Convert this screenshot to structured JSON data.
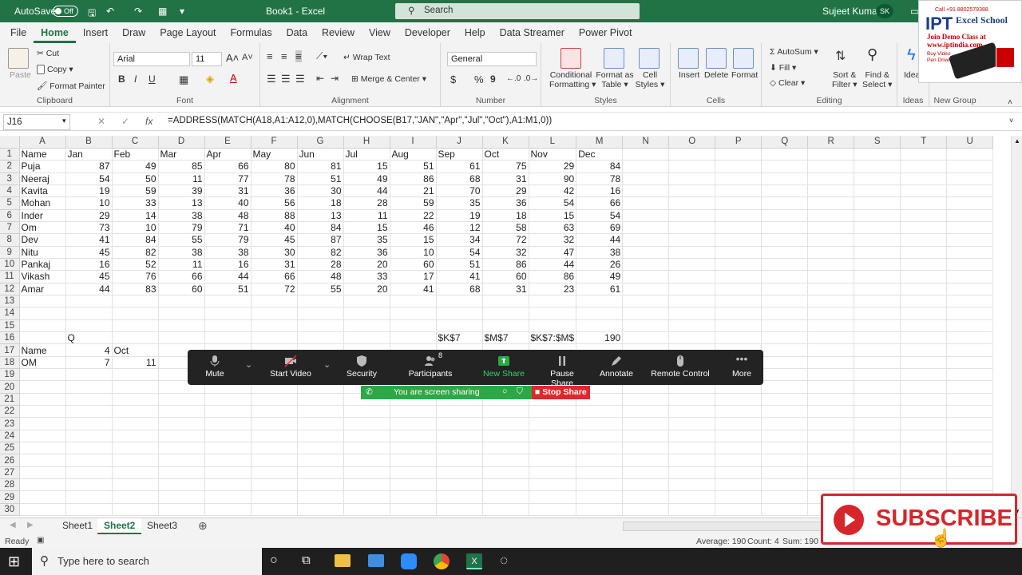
{
  "titlebar": {
    "autosave_label": "AutoSave",
    "autosave_state": "Off",
    "doc_title": "Book1 - Excel",
    "search_placeholder": "Search",
    "user_name": "Sujeet Kumar",
    "user_initials": "SK"
  },
  "ribbon_tabs": [
    "File",
    "Home",
    "Insert",
    "Draw",
    "Page Layout",
    "Formulas",
    "Data",
    "Review",
    "View",
    "Developer",
    "Help",
    "Data Streamer",
    "Power Pivot"
  ],
  "active_tab": "Home",
  "ribbon": {
    "clipboard": {
      "label": "Clipboard",
      "paste": "Paste",
      "cut": "Cut",
      "copy": "Copy",
      "format_painter": "Format Painter"
    },
    "font": {
      "label": "Font",
      "font_name": "Arial",
      "font_size": "11",
      "bold": "B",
      "italic": "I",
      "underline": "U"
    },
    "alignment": {
      "label": "Alignment",
      "wrap_text": "Wrap Text",
      "merge_center": "Merge & Center"
    },
    "number": {
      "label": "Number",
      "format": "General",
      "currency": "$",
      "percent": "%",
      "comma": "9"
    },
    "styles": {
      "label": "Styles",
      "conditional": "Conditional",
      "formatting": "Formatting",
      "format_as": "Format as",
      "table": "Table",
      "cell": "Cell",
      "cell_styles": "Styles"
    },
    "cells": {
      "label": "Cells",
      "insert": "Insert",
      "delete": "Delete",
      "format": "Format"
    },
    "editing": {
      "label": "Editing",
      "autosum": "AutoSum",
      "fill": "Fill",
      "clear": "Clear",
      "sort": "Sort &",
      "filter": "Filter",
      "find": "Find &",
      "select": "Select"
    },
    "ideas": {
      "label": "Ideas",
      "ideas_btn": "Ideas"
    },
    "new_group": {
      "label": "New Group"
    }
  },
  "formula_bar": {
    "name_box": "J16",
    "cancel": "✕",
    "enter": "✓",
    "fx": "fx",
    "formula": "=ADDRESS(MATCH(A18,A1:A12,0),MATCH(CHOOSE(B17,\"JAN\",\"Apr\",\"Jul\",\"Oct\"),A1:M1,0))"
  },
  "grid": {
    "columns": [
      "A",
      "B",
      "C",
      "D",
      "E",
      "F",
      "G",
      "H",
      "I",
      "J",
      "K",
      "L",
      "M",
      "N",
      "O",
      "P",
      "Q",
      "R",
      "S",
      "T",
      "U"
    ],
    "rows": [
      [
        "Name",
        "Jan",
        "Feb",
        "Mar",
        "Apr",
        "May",
        "Jun",
        "Jul",
        "Aug",
        "Sep",
        "Oct",
        "Nov",
        "Dec"
      ],
      [
        "Puja",
        "87",
        "49",
        "85",
        "66",
        "80",
        "81",
        "15",
        "51",
        "61",
        "75",
        "29",
        "84"
      ],
      [
        "Neeraj",
        "54",
        "50",
        "11",
        "77",
        "78",
        "51",
        "49",
        "86",
        "68",
        "31",
        "90",
        "78"
      ],
      [
        "Kavita",
        "19",
        "59",
        "39",
        "31",
        "36",
        "30",
        "44",
        "21",
        "70",
        "29",
        "42",
        "16"
      ],
      [
        "Mohan",
        "10",
        "33",
        "13",
        "40",
        "56",
        "18",
        "28",
        "59",
        "35",
        "36",
        "54",
        "66"
      ],
      [
        "Inder",
        "29",
        "14",
        "38",
        "48",
        "88",
        "13",
        "11",
        "22",
        "19",
        "18",
        "15",
        "54"
      ],
      [
        "Om",
        "73",
        "10",
        "79",
        "71",
        "40",
        "84",
        "15",
        "46",
        "12",
        "58",
        "63",
        "69"
      ],
      [
        "Dev",
        "41",
        "84",
        "55",
        "79",
        "45",
        "87",
        "35",
        "15",
        "34",
        "72",
        "32",
        "44"
      ],
      [
        "Nitu",
        "45",
        "82",
        "38",
        "38",
        "30",
        "82",
        "36",
        "10",
        "54",
        "32",
        "47",
        "38"
      ],
      [
        "Pankaj",
        "16",
        "52",
        "11",
        "16",
        "31",
        "28",
        "20",
        "60",
        "51",
        "86",
        "44",
        "26"
      ],
      [
        "Vikash",
        "45",
        "76",
        "66",
        "44",
        "66",
        "48",
        "33",
        "17",
        "41",
        "60",
        "86",
        "49"
      ],
      [
        "Amar",
        "44",
        "83",
        "60",
        "51",
        "72",
        "55",
        "20",
        "41",
        "68",
        "31",
        "23",
        "61"
      ],
      [],
      [],
      [],
      [
        "",
        "Q",
        "",
        "",
        "",
        "",
        "",
        "",
        "",
        "$K$7",
        "$M$7",
        "$K$7:$M$",
        "190"
      ],
      [
        "Name",
        "4",
        "Oct"
      ],
      [
        "OM",
        "7",
        "11"
      ],
      [],
      [],
      [],
      [],
      [],
      [],
      [],
      [],
      [],
      [],
      [],
      []
    ]
  },
  "sheets": [
    "Sheet1",
    "Sheet2",
    "Sheet3"
  ],
  "active_sheet": "Sheet2",
  "statusbar": {
    "ready": "Ready",
    "average": "Average: 190",
    "count": "Count: 4",
    "sum": "Sum: 190"
  },
  "taskbar": {
    "search_placeholder": "Type here to search"
  },
  "zoom": {
    "mute": "Mute",
    "start_video": "Start Video",
    "security": "Security",
    "participants": "Participants",
    "participants_count": "8",
    "new_share": "New Share",
    "pause_share": "Pause Share",
    "annotate": "Annotate",
    "remote_control": "Remote Control",
    "more": "More",
    "sharing_text": "You are screen sharing",
    "stop_share": "Stop Share"
  },
  "overlay": {
    "subscribe": "SUBSCRIBE",
    "logo_phone": "Call +91 8802579388",
    "logo_brand": "IPT",
    "logo_school": "Excel School",
    "logo_line1": "Join Demo Class at",
    "logo_line2": "www.iptindia.com",
    "logo_line3": "Buy Video",
    "logo_line4": "Pen Drive"
  },
  "colors": {
    "excel_green": "#217346",
    "zoom_bg": "#232323",
    "share_green": "#2aa946",
    "stop_red": "#e0272d",
    "subscribe_red": "#d7262b"
  }
}
